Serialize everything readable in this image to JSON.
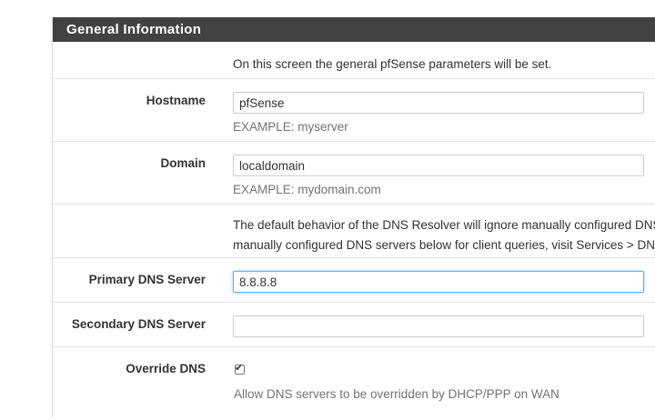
{
  "panel": {
    "title": "General Information"
  },
  "intro": {
    "text": "On this screen the general pfSense parameters will be set."
  },
  "hostname": {
    "label": "Hostname",
    "value": "pfSense",
    "help": "EXAMPLE: myserver"
  },
  "domain": {
    "label": "Domain",
    "value": "localdomain",
    "help": "EXAMPLE: mydomain.com"
  },
  "dns_note": {
    "line1": "The default behavior of the DNS Resolver will ignore manually configured DNS",
    "line2": "manually configured DNS servers below for client queries, visit Services > DNS"
  },
  "primary_dns": {
    "label": "Primary DNS Server",
    "value": "8.8.8.8"
  },
  "secondary_dns": {
    "label": "Secondary DNS Server",
    "value": ""
  },
  "override_dns": {
    "label": "Override DNS",
    "checked": true,
    "check_glyph": "✔",
    "help": "Allow DNS servers to be overridden by DHCP/PPP on WAN"
  }
}
